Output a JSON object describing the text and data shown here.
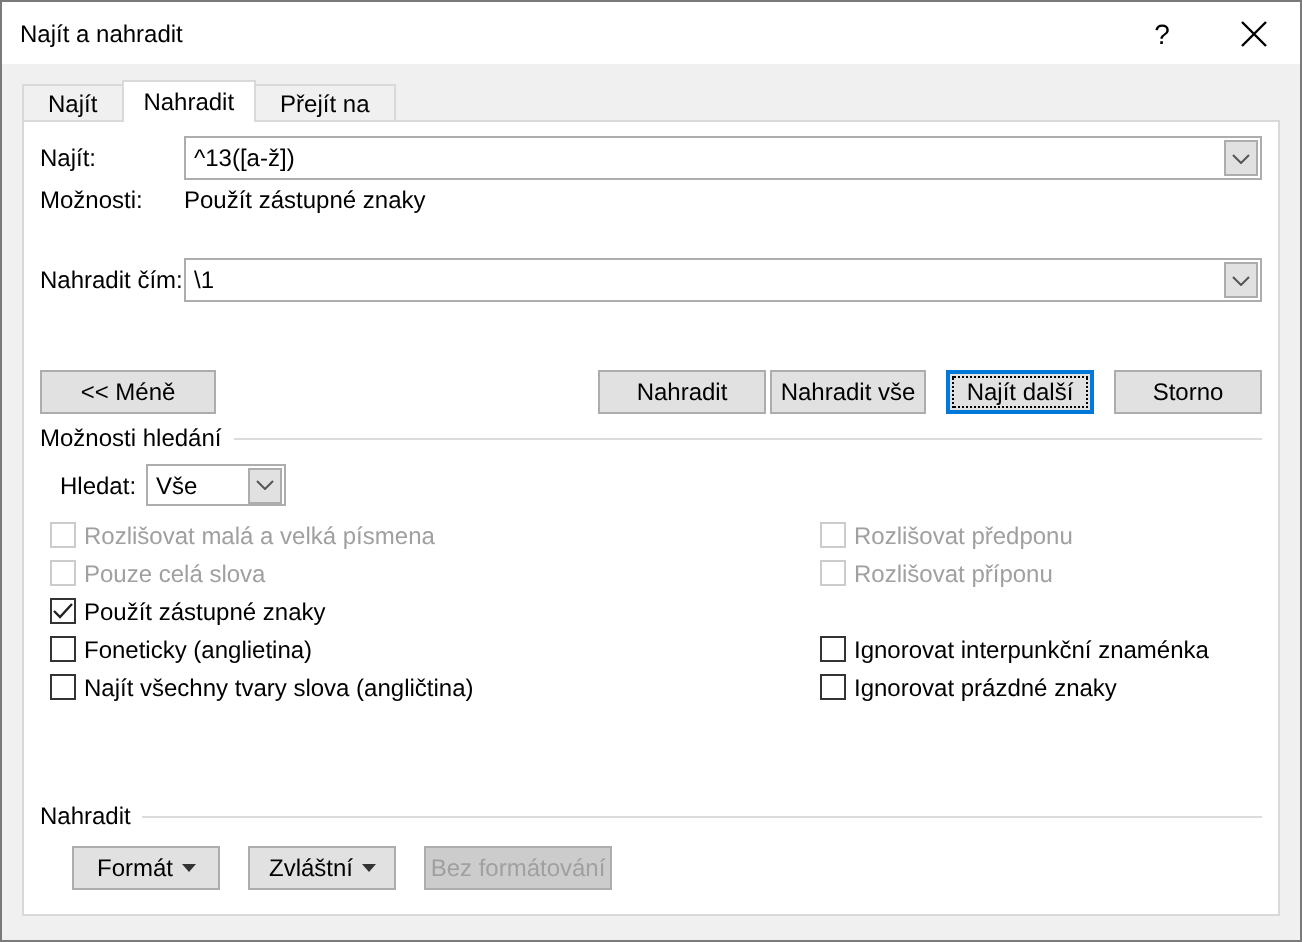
{
  "window": {
    "title": "Najít a nahradit",
    "help": "?"
  },
  "tabs": [
    {
      "label": "Najít",
      "selected": false
    },
    {
      "label": "Nahradit",
      "selected": true
    },
    {
      "label": "Přejít na",
      "selected": false
    }
  ],
  "find": {
    "label": "Najít:",
    "value": "^13([a-ž])"
  },
  "options_info": {
    "label": "Možnosti:",
    "value": "Použít zástupné znaky"
  },
  "replace": {
    "label": "Nahradit čím:",
    "value": "\\1"
  },
  "buttons": [
    {
      "label": "<< Méně",
      "default": false
    },
    {
      "label": "Nahradit",
      "default": false
    },
    {
      "label": "Nahradit vše",
      "default": false
    },
    {
      "label": "Najít další",
      "default": true
    },
    {
      "label": "Storno",
      "default": false
    }
  ],
  "search_options": {
    "title": "Možnosti hledání",
    "direction_label": "Hledat:",
    "direction_value": "Vše",
    "rows": [
      {
        "left": {
          "label": "Rozlišovat malá a velká písmena",
          "checked": false,
          "disabled": true
        },
        "right": {
          "label": "Rozlišovat předponu",
          "checked": false,
          "disabled": true
        }
      },
      {
        "left": {
          "label": "Pouze celá slova",
          "checked": false,
          "disabled": true
        },
        "right": {
          "label": "Rozlišovat příponu",
          "checked": false,
          "disabled": true
        }
      },
      {
        "left": {
          "label": "Použít zástupné znaky",
          "checked": true,
          "disabled": false
        }
      },
      {
        "left": {
          "label": "Foneticky (anglietina)",
          "checked": false,
          "disabled": false
        },
        "right": {
          "label": "Ignorovat interpunkční znaménka",
          "checked": false,
          "disabled": false
        }
      },
      {
        "left": {
          "label": "Najít všechny tvary slova (angličtina)",
          "checked": false,
          "disabled": false
        },
        "right": {
          "label": "Ignorovat prázdné znaky",
          "checked": false,
          "disabled": false
        }
      }
    ]
  },
  "replace_section": {
    "title": "Nahradit",
    "buttons": [
      {
        "label": "Formát",
        "dropdown": true,
        "disabled": false
      },
      {
        "label": "Zvláštní",
        "dropdown": true,
        "disabled": false
      },
      {
        "label": "Bez formátování",
        "dropdown": false,
        "disabled": true
      }
    ]
  }
}
